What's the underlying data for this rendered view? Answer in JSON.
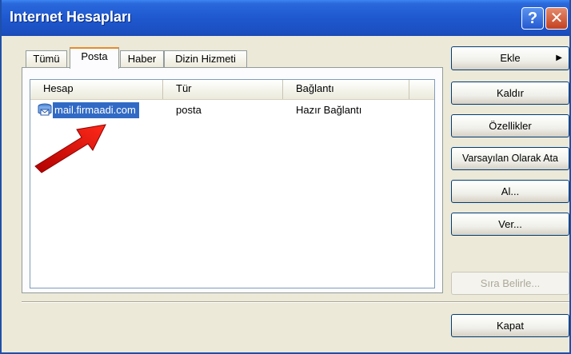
{
  "window": {
    "title": "Internet Hesapları",
    "help_glyph": "?",
    "close_glyph": "✕"
  },
  "tabs": [
    {
      "label": "Tümü",
      "active": false
    },
    {
      "label": "Posta",
      "active": true
    },
    {
      "label": "Haber",
      "active": false
    },
    {
      "label": "Dizin Hizmeti",
      "active": false
    }
  ],
  "list": {
    "columns": [
      "Hesap",
      "Tür",
      "Bağlantı"
    ],
    "rows": [
      {
        "hesap": "mail.firmaadi.com",
        "tur": "posta",
        "baglanti": "Hazır Bağlantı",
        "selected": true,
        "icon": "mail-account-icon"
      }
    ]
  },
  "buttons": {
    "ekle": "Ekle",
    "kaldir": "Kaldır",
    "ozellikler": "Özellikler",
    "varsayilan": "Varsayılan Olarak Ata",
    "al": "Al...",
    "ver": "Ver...",
    "sira": "Sıra Belirle...",
    "kapat": "Kapat"
  },
  "colors": {
    "title_bar": "#1f58cf",
    "selection": "#316ac5",
    "arrow": "#e01010",
    "close_button": "#c4411f"
  }
}
